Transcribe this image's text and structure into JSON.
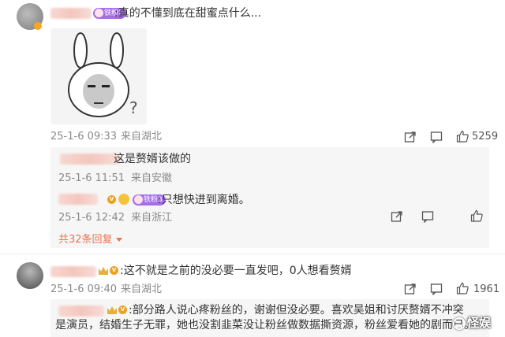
{
  "comments": [
    {
      "badge_text": "铁粉2",
      "text": ":真的不懂到底在甜蜜点什么...",
      "time": "25-1-6 09:33",
      "location": "来自湖北",
      "likes": "5259",
      "sticker_icon": "rabbit-meme-sticker",
      "replies": [
        {
          "text": "这是赘婿该做的",
          "time": "25-1-6 11:51",
          "location": "来自安徽"
        },
        {
          "badge_text": "铁粉3",
          "text": ":只想快进到离婚。",
          "time": "25-1-6 12:42",
          "location": "来自浙江"
        }
      ],
      "more_replies": "共32条回复"
    },
    {
      "text": ":这不就是之前的没必要一直发吧，0人想看赘婿",
      "time": "25-1-6 09:40",
      "location": "来自湖北",
      "likes": "1961",
      "replies": [
        {
          "text_line1": ":部分路人说心疼粉丝的，谢谢但没必要。喜欢吴姐和讨厌赘婿不冲突",
          "text_line2": "是演员，结婚生子无罪，她也没割韭菜没让粉丝做数据撕资源，粉丝爱看她的剧而已。"
        }
      ]
    }
  ],
  "watermark": "怪娱",
  "colors": {
    "accent": "#eb7350",
    "fan_badge": "#a56ee8",
    "icon": "#555555"
  },
  "icons": [
    "share-icon",
    "comment-icon",
    "like-icon"
  ]
}
